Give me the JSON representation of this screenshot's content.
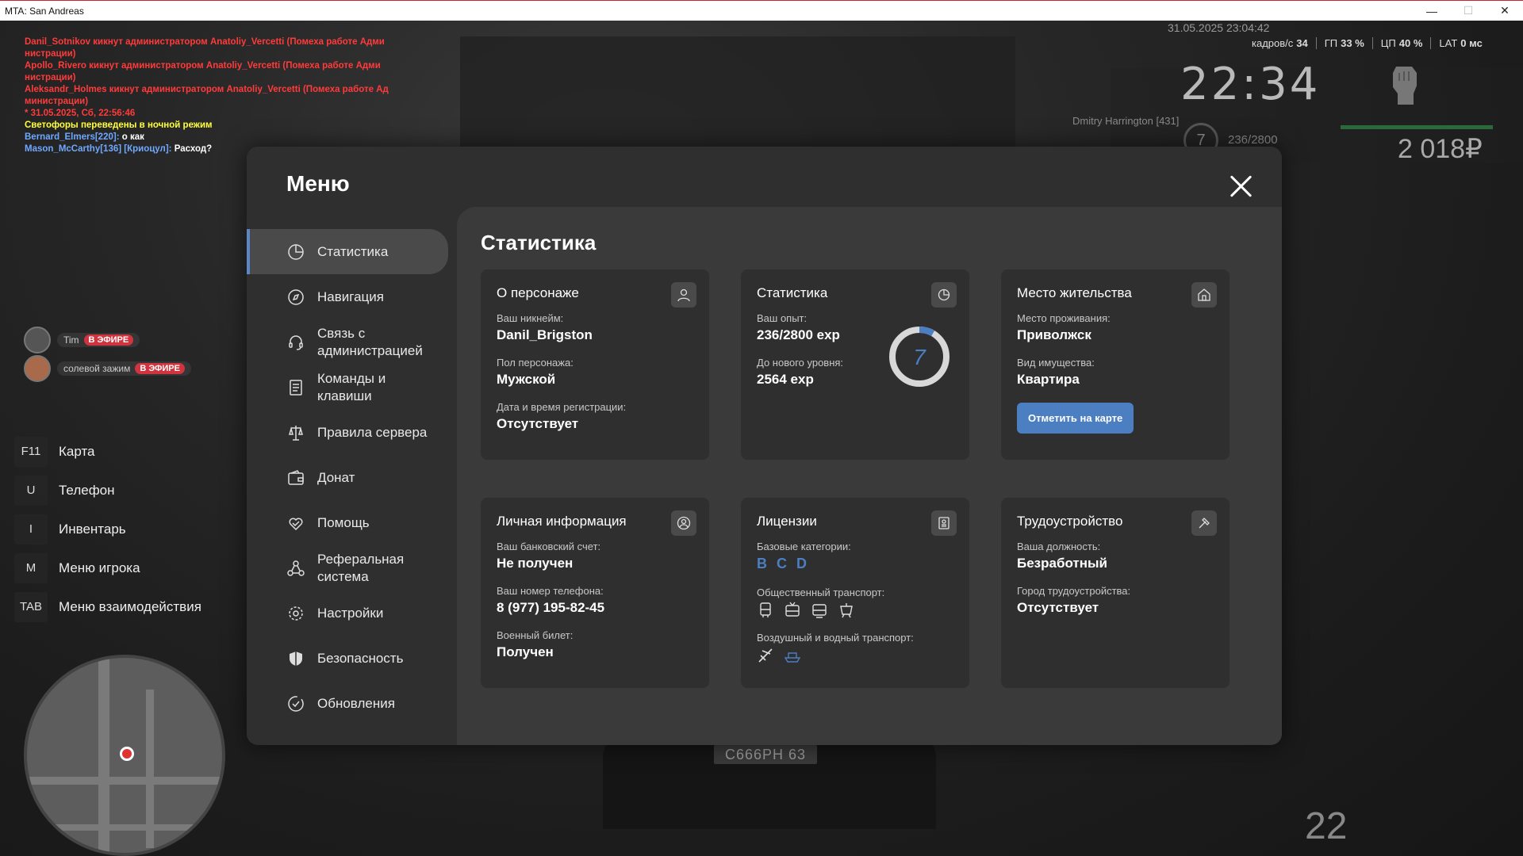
{
  "window": {
    "title": "MTA: San Andreas",
    "minimize": "—",
    "maximize": "☐",
    "close": "✕"
  },
  "chat": [
    {
      "color": "red",
      "text": "Danil_Sotnikov кикнут администратором Anatoliy_Vercetti (Помеха работе Адми"
    },
    {
      "color": "red",
      "text": "нистрации)"
    },
    {
      "color": "red",
      "text": "Apollo_Rivero кикнут администратором Anatoliy_Vercetti (Помеха работе Адми"
    },
    {
      "color": "red",
      "text": "нистрации)"
    },
    {
      "color": "red",
      "text": "Aleksandr_Holmes кикнут администратором Anatoliy_Vercetti (Помеха работе Ад"
    },
    {
      "color": "red",
      "text": "министрации)"
    },
    {
      "color": "red",
      "text": "* 31.05.2025, Сб, 22:56:46"
    },
    {
      "color": "yellow",
      "text": "Светофоры переведены в ночной режим"
    },
    {
      "color": "blue",
      "text": "Bernard_Elmers[220]:",
      "rest": " о как"
    },
    {
      "color": "blue",
      "text": "Mason_McCarthy[136] [Криоцул]:",
      "rest": " Расход?"
    }
  ],
  "hud": {
    "datetime": "31.05.2025 23:04:42",
    "fps_label": "кадров/с",
    "fps": "34",
    "gpu_label": "ГП",
    "gpu": "33 %",
    "cpu_label": "ЦП",
    "cpu": "40 %",
    "lat_label": "LAT",
    "lat": "0 мс",
    "clock": "22:34",
    "money": "2 018₽",
    "player": "Dmitry Harrington [431]",
    "level": "7",
    "exp": "236/2800",
    "speed": "22"
  },
  "voice": [
    {
      "name": "Tim",
      "badge": "В ЭФИРЕ"
    },
    {
      "name": "солевой зажим",
      "badge": "В ЭФИРЕ"
    }
  ],
  "keybinds": [
    {
      "key": "F11",
      "label": "Карта"
    },
    {
      "key": "U",
      "label": "Телефон"
    },
    {
      "key": "I",
      "label": "Инвентарь"
    },
    {
      "key": "M",
      "label": "Меню игрока"
    },
    {
      "key": "TAB",
      "label": "Меню взаимодействия"
    }
  ],
  "plate": "С666РН 63",
  "menu": {
    "title": "Меню",
    "items": [
      {
        "label": "Статистика",
        "icon": "pie-chart-icon",
        "active": true
      },
      {
        "label": "Навигация",
        "icon": "compass-icon"
      },
      {
        "label": "Связь с администрацией",
        "icon": "headset-icon"
      },
      {
        "label": "Команды и клавиши",
        "icon": "document-icon"
      },
      {
        "label": "Правила сервера",
        "icon": "scales-icon"
      },
      {
        "label": "Донат",
        "icon": "wallet-icon"
      },
      {
        "label": "Помощь",
        "icon": "heart-hand-icon"
      },
      {
        "label": "Реферальная система",
        "icon": "referral-icon"
      },
      {
        "label": "Настройки",
        "icon": "gear-icon"
      },
      {
        "label": "Безопасность",
        "icon": "shield-icon"
      },
      {
        "label": "Обновления",
        "icon": "update-check-icon"
      }
    ]
  },
  "stats": {
    "title": "Статистика",
    "character": {
      "title": "О персонаже",
      "nick_label": "Ваш никнейм:",
      "nick": "Danil_Brigston",
      "gender_label": "Пол персонажа:",
      "gender": "Мужской",
      "reg_label": "Дата и время регистрации:",
      "reg": "Отсутствует"
    },
    "statistics": {
      "title": "Статистика",
      "exp_label": "Ваш опыт:",
      "exp": "236/2800 exp",
      "next_label": "До нового уровня:",
      "next": "2564 exp",
      "level": "7",
      "progress": 0.084
    },
    "residence": {
      "title": "Место жительства",
      "place_label": "Место проживания:",
      "place": "Приволжск",
      "type_label": "Вид имущества:",
      "type": "Квартира",
      "button": "Отметить на карте"
    },
    "personal": {
      "title": "Личная информация",
      "bank_label": "Ваш банковский счет:",
      "bank": "Не получен",
      "phone_label": "Ваш номер телефона:",
      "phone": "8 (977) 195-82-45",
      "military_label": "Военный билет:",
      "military": "Получен"
    },
    "licenses": {
      "title": "Лицензии",
      "base_label": "Базовые категории:",
      "base": [
        "B",
        "C",
        "D"
      ],
      "public_label": "Общественный транспорт:",
      "air_label": "Воздушный и водный транспорт:"
    },
    "job": {
      "title": "Трудоустройство",
      "position_label": "Ваша должность:",
      "position": "Безработный",
      "city_label": "Город трудоустройства:",
      "city": "Отсутствует"
    }
  }
}
